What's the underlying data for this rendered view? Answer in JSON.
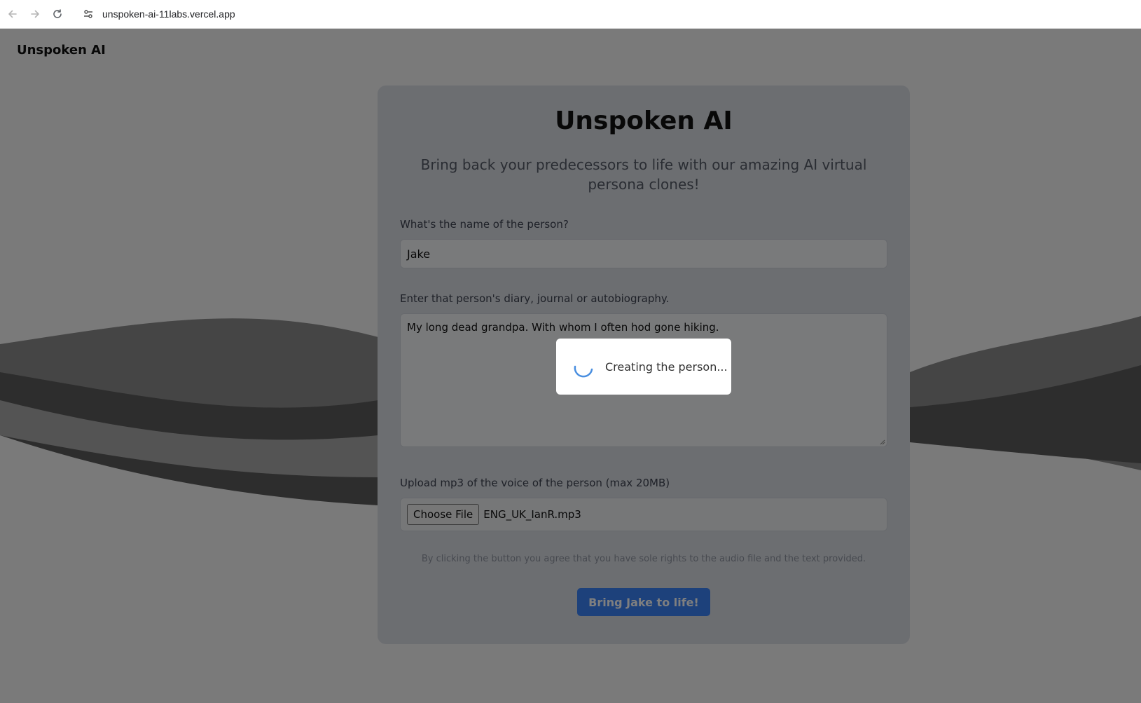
{
  "browser": {
    "url": "unspoken-ai-11labs.vercel.app"
  },
  "header": {
    "brand": "Unspoken AI"
  },
  "card": {
    "title": "Unspoken AI",
    "subtitle": "Bring back your predecessors to life with our amazing AI virtual persona clones!",
    "name_label": "What's the name of the person?",
    "name_value": "Jake",
    "diary_label": "Enter that person's diary, journal or autobiography.",
    "diary_value": "My long dead grandpa. With whom I often hod gone hiking.",
    "upload_label": "Upload mp3 of the voice of the person (max 20MB)",
    "choose_file_label": "Choose File",
    "file_name": "ENG_UK_IanR.mp3",
    "disclaimer": "By clicking the button you agree that you have sole rights to the audio file and the text provided.",
    "submit_label": "Bring Jake to life!"
  },
  "loading": {
    "message": "Creating the person..."
  },
  "colors": {
    "accent": "#3b82f6",
    "card_bg": "#d9dce3",
    "overlay": "rgba(0,0,0,0.5)"
  },
  "icons": {
    "back": "arrow-left-icon",
    "forward": "arrow-right-icon",
    "reload": "reload-icon",
    "site_info": "tune-icon",
    "spinner": "spinner-icon"
  }
}
